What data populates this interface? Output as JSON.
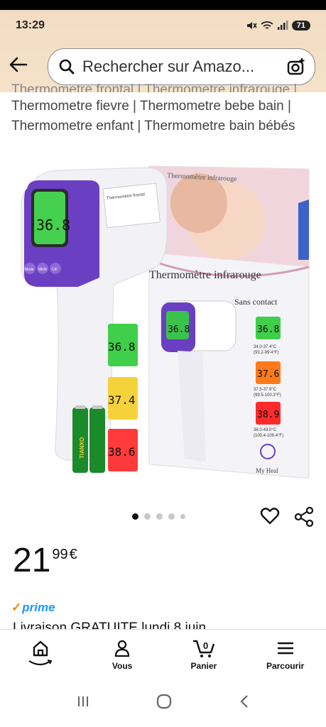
{
  "status_bar": {
    "time": "13:29",
    "battery": "71"
  },
  "search": {
    "placeholder": "Rechercher sur Amazo..."
  },
  "product": {
    "title_partial_top": "Thermometre frontal | Thermometre infrarouge |",
    "title": "Thermometre fievre | Thermometre bebe bain | Thermometre enfant | Thermometre bain bébés",
    "image": {
      "box_heading": "Thermomètre infrarouge",
      "box_subheading": "Sans contact",
      "box_top_text": "Thermomètre infrarouge",
      "brand": "My Heal",
      "device_reading": "36.8",
      "device_label": "Thermomètre frontal",
      "device_buttons": [
        "Mode",
        "MEM",
        "C/F"
      ],
      "readings": [
        {
          "value": "36.8",
          "range_c": "34.0-37.4°C",
          "range_f": "(93.2-99.4°F)",
          "color": "#3fcf4a"
        },
        {
          "value": "37.6",
          "range_c": "37.5-37.9°C",
          "range_f": "(99.5-100.3°F)",
          "color": "#ff7a1a"
        },
        {
          "value": "38.9",
          "range_c": "38.0-43.0°C",
          "range_f": "(100.4-109.4°F)",
          "color": "#ff2a2a"
        }
      ],
      "left_readings": [
        "36.8",
        "37.4",
        "38.6"
      ],
      "battery_brand": "TIANXO"
    },
    "carousel": {
      "count": 5,
      "active_index": 0
    },
    "price": {
      "whole": "21",
      "fraction": "99",
      "currency": "€"
    },
    "prime_label": "prime",
    "delivery_partial": "Livraison GRATUITE lundi 8 juin"
  },
  "bottom_nav": {
    "items": [
      {
        "label": "",
        "name": "home"
      },
      {
        "label": "Vous",
        "name": "you"
      },
      {
        "label": "Panier",
        "name": "cart",
        "badge": "0"
      },
      {
        "label": "Parcourir",
        "name": "menu"
      }
    ]
  },
  "colors": {
    "accent_teal": "#007185",
    "prime_blue": "#1a98ff",
    "header_bg": "#f3dcc1",
    "device_purple": "#6a3fc2"
  }
}
